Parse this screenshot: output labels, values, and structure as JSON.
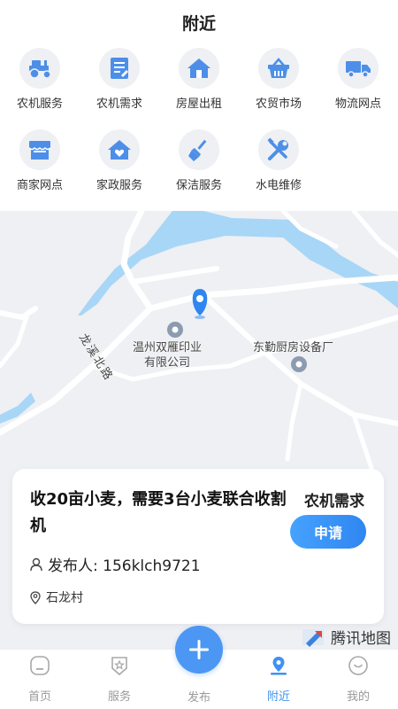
{
  "header": {
    "title": "附近"
  },
  "services": [
    {
      "label": "农机服务",
      "icon": "tractor-icon"
    },
    {
      "label": "农机需求",
      "icon": "document-icon"
    },
    {
      "label": "房屋出租",
      "icon": "house-icon"
    },
    {
      "label": "农贸市场",
      "icon": "basket-icon"
    },
    {
      "label": "物流网点",
      "icon": "truck-icon"
    },
    {
      "label": "商家网点",
      "icon": "store-icon"
    },
    {
      "label": "家政服务",
      "icon": "heart-house-icon"
    },
    {
      "label": "保洁服务",
      "icon": "broom-icon"
    },
    {
      "label": "水电维修",
      "icon": "wrench-screwdriver-icon"
    }
  ],
  "map": {
    "poi_1": "温州双雁印业\n有限公司",
    "poi_2": "东勤厨房设备厂",
    "road": "龙溪北路",
    "watermark": "腾讯地图"
  },
  "card": {
    "title": "收20亩小麦，需要3台小麦联合收割机",
    "tag": "农机需求",
    "apply": "申请",
    "publisher": "发布人: 156klch9721",
    "location": "石龙村"
  },
  "tabs": [
    {
      "label": "首页",
      "icon": "home-icon"
    },
    {
      "label": "服务",
      "icon": "service-icon"
    },
    {
      "label": "发布",
      "icon": "plus-icon"
    },
    {
      "label": "附近",
      "icon": "nearby-icon",
      "active": true
    },
    {
      "label": "我的",
      "icon": "profile-icon"
    }
  ],
  "colors": {
    "accent": "#3f92f2",
    "icon_bg": "#eef0f3",
    "water": "#a6d4f5",
    "road": "#ffffff",
    "map_bg": "#eef0f4"
  }
}
